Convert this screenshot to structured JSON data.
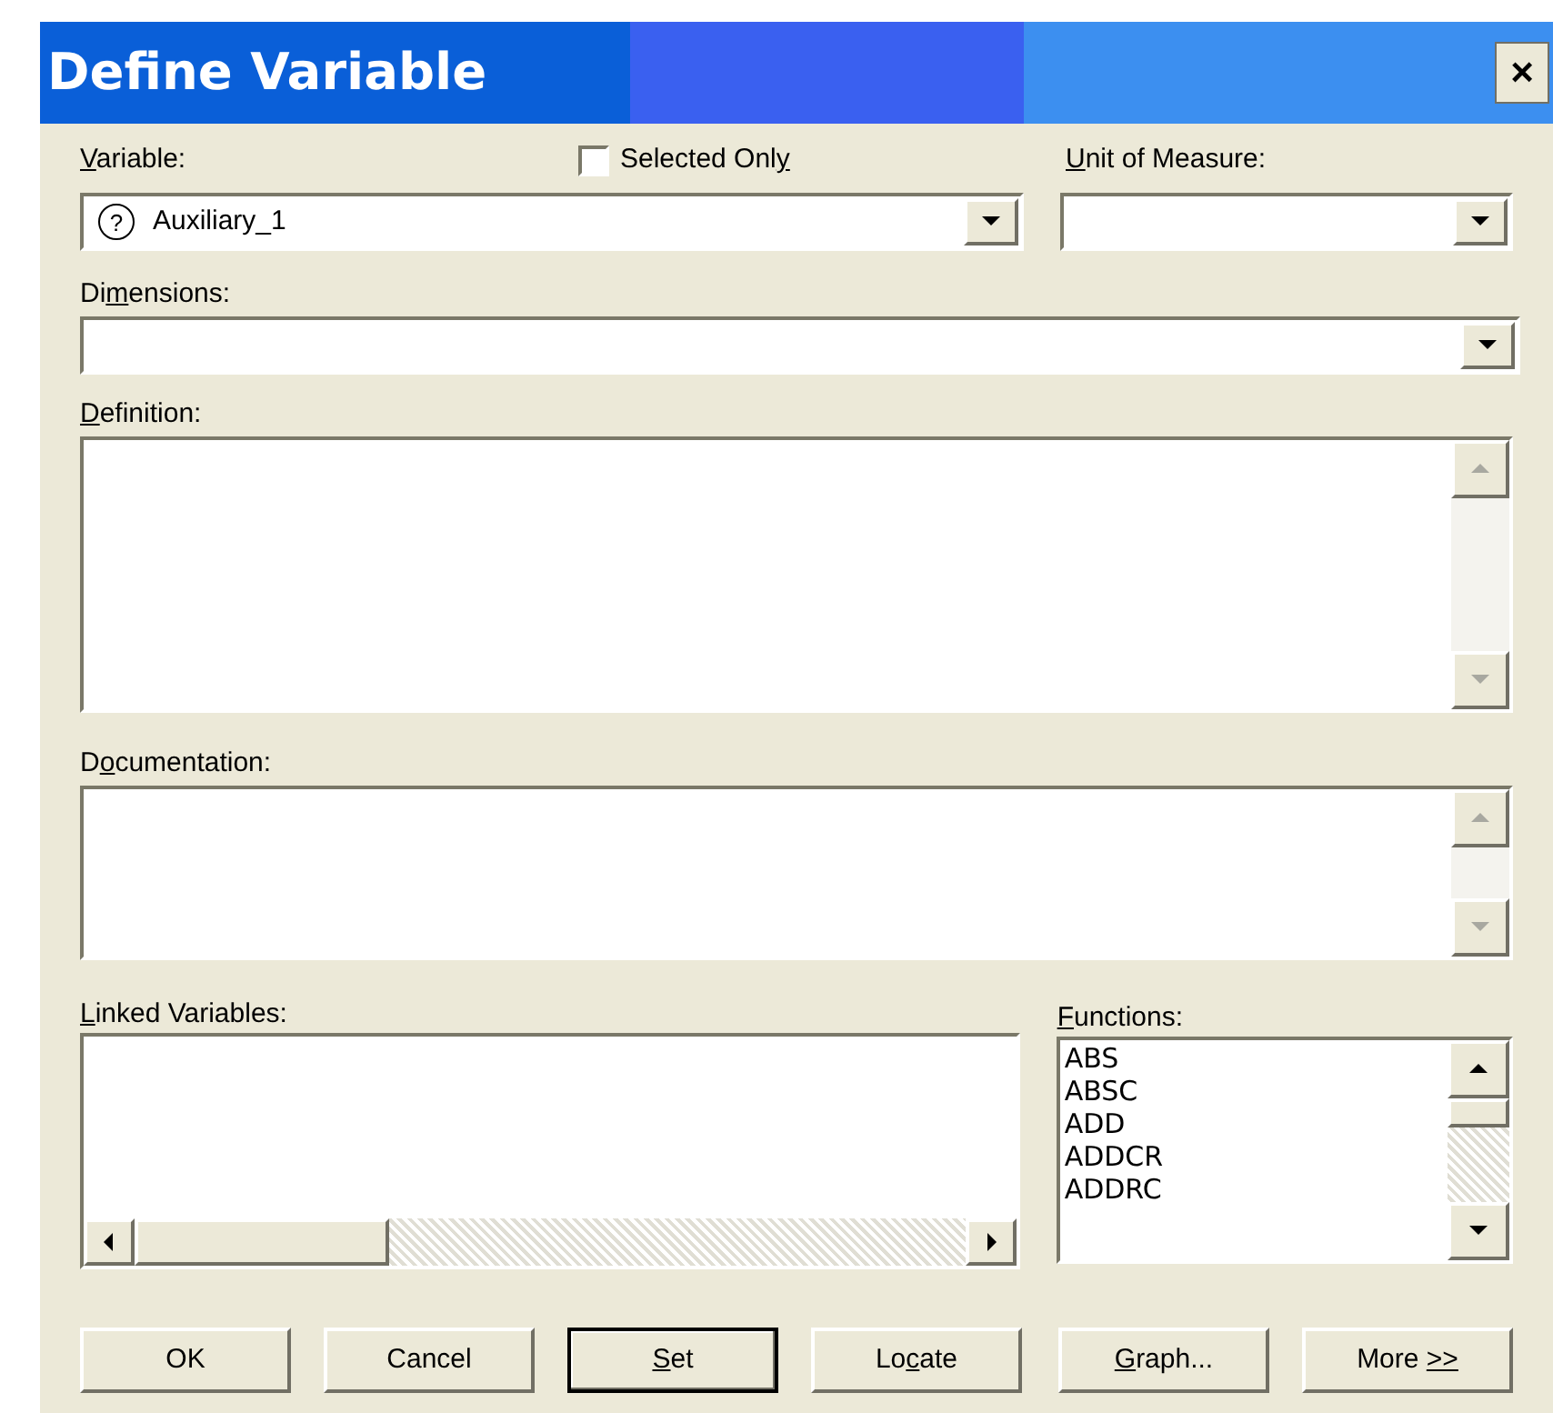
{
  "window": {
    "title": "Define Variable",
    "close": "×"
  },
  "variable": {
    "label": {
      "key": "V",
      "post": "ariable:"
    },
    "icon": "?",
    "value": "Auxiliary_1"
  },
  "selected_only": {
    "label": {
      "pre": "Selected Onl",
      "key": "y"
    },
    "checked": false
  },
  "unit": {
    "label": {
      "key": "U",
      "post": "nit of Measure:"
    }
  },
  "dimensions": {
    "label": {
      "pre": "Di",
      "key": "m",
      "post": "ensions:"
    }
  },
  "definition": {
    "label": {
      "key": "D",
      "post": "efinition:"
    },
    "disabled_scroll": true
  },
  "documentation": {
    "label": {
      "pre": "D",
      "key": "o",
      "post": "cumentation:"
    },
    "disabled_scroll": true
  },
  "linked": {
    "label": {
      "key": "L",
      "post": "inked Variables:"
    }
  },
  "functions": {
    "label": {
      "key": "F",
      "post": "unctions:"
    },
    "items": [
      "ABS",
      "ABSC",
      "ADD",
      "ADDCR",
      "ADDRC"
    ]
  },
  "buttons": [
    {
      "label": {
        "pre": "OK"
      },
      "default": false
    },
    {
      "label": {
        "pre": "Cancel"
      },
      "default": false
    },
    {
      "label": {
        "key": "S",
        "post": "et"
      },
      "default": true
    },
    {
      "label": {
        "pre": "Lo",
        "key": "c",
        "post": "ate"
      },
      "default": false
    },
    {
      "label": {
        "key": "G",
        "post": "raph..."
      },
      "default": false
    },
    {
      "label": {
        "pre": "More ",
        "key": ">>"
      },
      "default": false
    }
  ]
}
